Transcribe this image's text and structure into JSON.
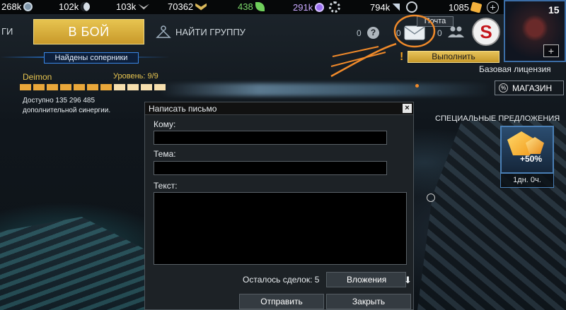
{
  "resources": [
    {
      "value": "268k",
      "icon": "credits-icon",
      "color": "#9fb7c9"
    },
    {
      "value": "102k",
      "icon": "moon-icon",
      "color": "#c9d6e3"
    },
    {
      "value": "103k",
      "icon": "wings-icon",
      "color": "#c9c9c9"
    },
    {
      "value": "70362",
      "icon": "rank-icon",
      "color": "#d9b85a"
    },
    {
      "value": "438",
      "icon": "leaf-icon",
      "color": "#7bd86a"
    },
    {
      "value": "291k",
      "icon": "orb-icon",
      "color": "#b48cff"
    },
    {
      "value": "794k",
      "icon": "component-icon",
      "color": "#c9d6e3"
    },
    {
      "value": "1085",
      "icon": "gold-icon",
      "color": "#f3b13c"
    }
  ],
  "nav": {
    "left_tab": "ГИ",
    "battle_label": "В БОЙ",
    "find_group_label": "НАЙТИ ГРУППУ"
  },
  "rivals": {
    "tag": "Найдены соперники",
    "player_name": "Deimon",
    "level": "Уровень: 9/9",
    "progress_fraction": 0.62,
    "synergy_line1": "Доступно 135 296 485",
    "synergy_line2": "дополнительной синергии."
  },
  "header_right": {
    "help_count": "0",
    "mail_count": "0",
    "group_count": "0",
    "mail_tooltip": "Почта",
    "player_level": "15",
    "execute_label": "Выполнить",
    "license": "Базовая лицензия",
    "shop_label": "МАГАЗИН",
    "special_offers": "СПЕЦИАЛЬНЫЕ ПРЕДЛОЖЕНИЯ",
    "offer_bonus": "+50%",
    "offer_time": "1дн. 0ч."
  },
  "dialog": {
    "title": "Написать письмо",
    "close_symbol": "×",
    "to_label": "Кому:",
    "to_value": "",
    "subject_label": "Тема:",
    "subject_value": "",
    "text_label": "Текст:",
    "text_value": "",
    "deals_left": "Осталось сделок: 5",
    "attachments_label": "Вложения",
    "send_label": "Отправить",
    "close_label": "Закрыть"
  },
  "colors": {
    "accent_gold": "#e7c450",
    "annotation_orange": "#f08a2a",
    "rivals_blue": "#2a7fe6"
  }
}
